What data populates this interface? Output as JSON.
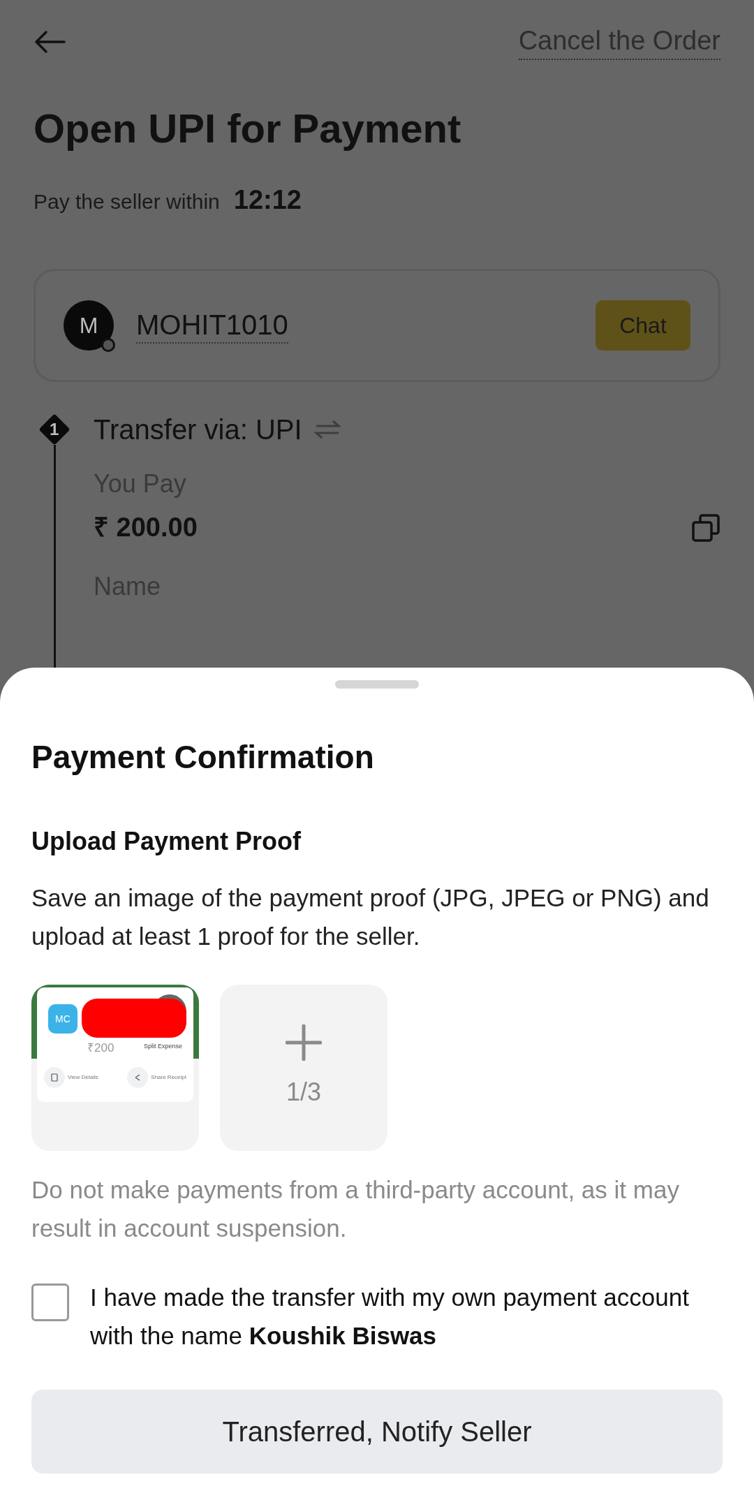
{
  "header": {
    "cancel_link": "Cancel the Order"
  },
  "title": "Open UPI for Payment",
  "timer": {
    "label": "Pay the seller within",
    "value": "12:12"
  },
  "seller": {
    "avatar_letter": "M",
    "name": "MOHIT1010",
    "chat_button": "Chat"
  },
  "step": {
    "number": "1",
    "title": "Transfer via: UPI",
    "fields": [
      {
        "label": "You Pay",
        "value": "₹ 200.00"
      },
      {
        "label": "Name"
      }
    ]
  },
  "sheet": {
    "title": "Payment Confirmation",
    "section_title": "Upload Payment Proof",
    "instructions": "Save an image of the payment proof (JPG, JPEG or PNG) and upload at least 1 proof for the seller.",
    "proof": {
      "initials": "MC",
      "amount": "₹200",
      "action": "Split Expense",
      "buttons": [
        "View Details",
        "Share Receipt"
      ]
    },
    "upload_count": "1/3",
    "warning": "Do not make payments from a third-party account, as it may result in account suspension.",
    "confirm": {
      "checked": false,
      "text": "I have made the transfer with my own payment account with the name **Koushik Biswas**"
    },
    "submit_button": "Transferred, Notify Seller"
  }
}
